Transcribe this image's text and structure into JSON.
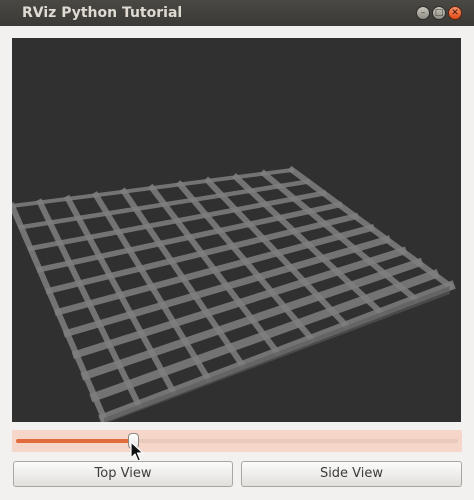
{
  "window": {
    "title": "RViz Python Tutorial",
    "controls": {
      "minimize_icon": "minimize-icon",
      "maximize_icon": "maximize-icon",
      "close_icon": "close-icon"
    }
  },
  "viewport": {
    "background": "#303030",
    "grid_color": "#7f7f7f",
    "grid_cells": 10
  },
  "slider": {
    "value": 0.26,
    "fill_color": "#e26b3e",
    "track_color": "#f6d6c8"
  },
  "buttons": {
    "top_view_label": "Top View",
    "side_view_label": "Side View"
  },
  "colors": {
    "titlebar": "#3c3b37",
    "close_button": "#df4a16"
  }
}
